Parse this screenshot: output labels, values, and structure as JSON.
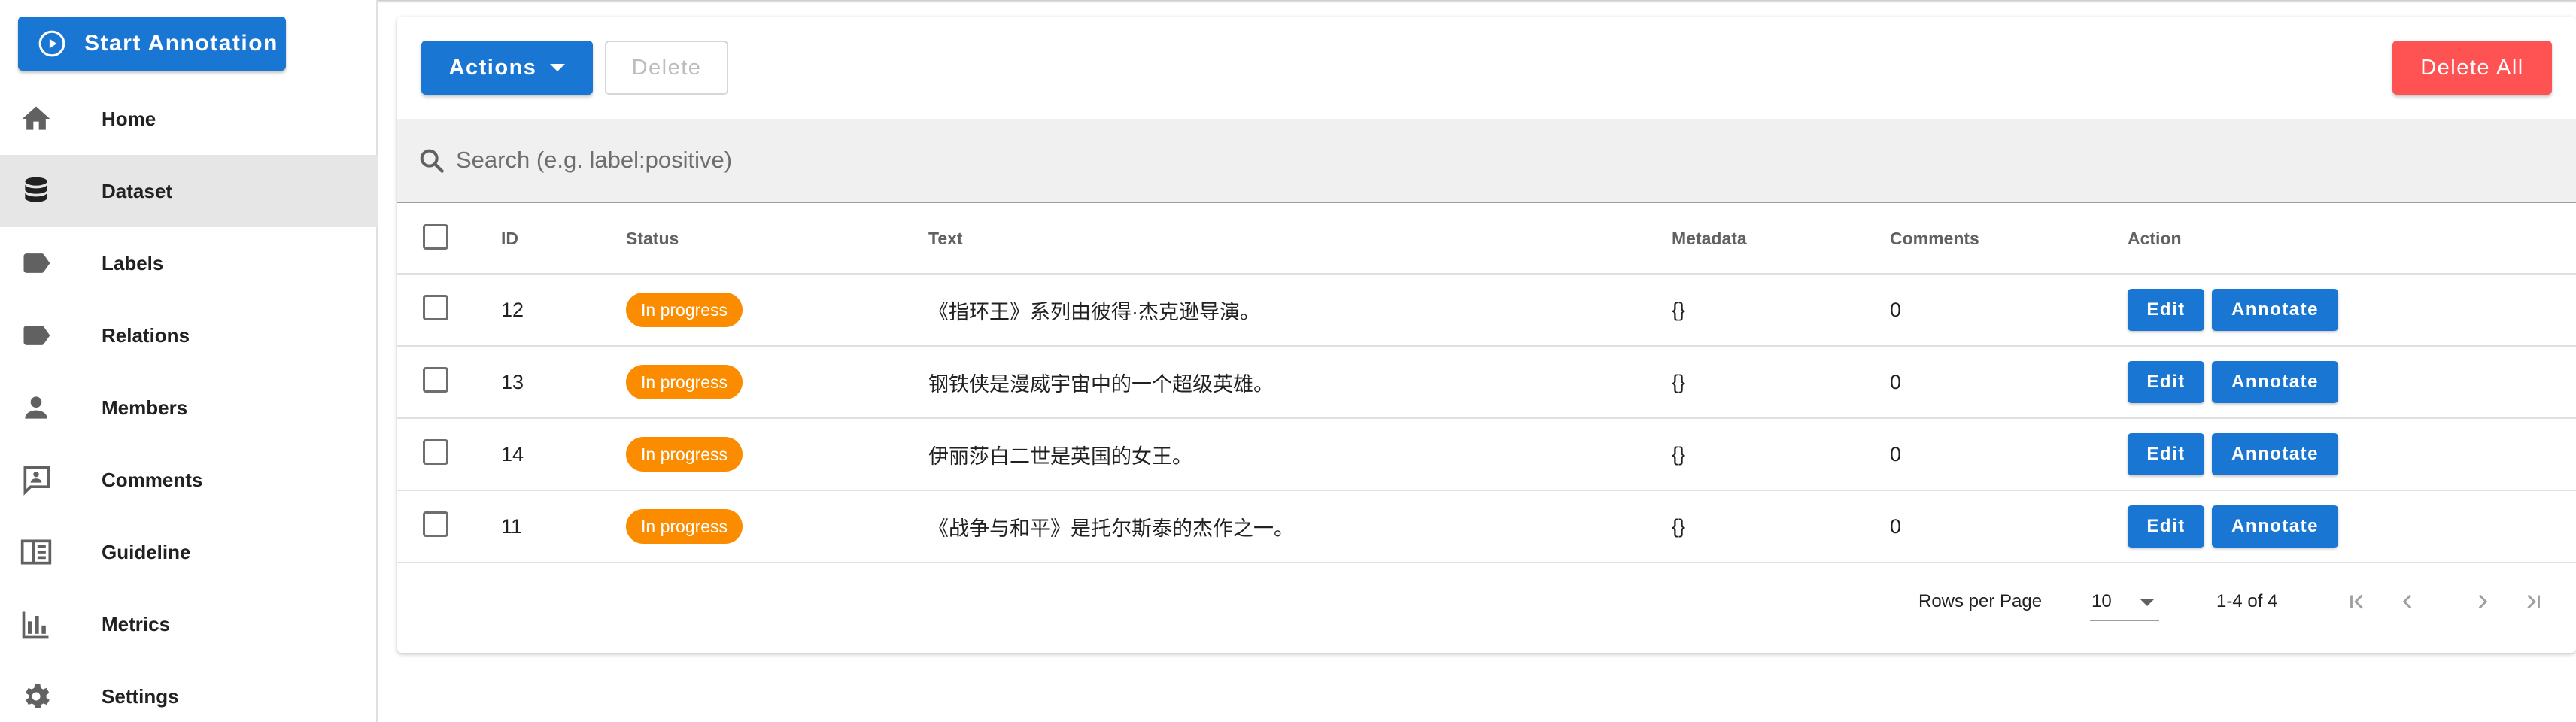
{
  "sidebar": {
    "start_button": "Start Annotation",
    "items": [
      {
        "label": "Home",
        "icon": "home-icon"
      },
      {
        "label": "Dataset",
        "icon": "database-icon"
      },
      {
        "label": "Labels",
        "icon": "label-icon"
      },
      {
        "label": "Relations",
        "icon": "label-icon"
      },
      {
        "label": "Members",
        "icon": "person-icon"
      },
      {
        "label": "Comments",
        "icon": "comment-icon"
      },
      {
        "label": "Guideline",
        "icon": "book-icon"
      },
      {
        "label": "Metrics",
        "icon": "bar-chart-icon"
      },
      {
        "label": "Settings",
        "icon": "gear-icon"
      }
    ],
    "active": "Dataset"
  },
  "toolbar": {
    "actions_label": "Actions",
    "delete_label": "Delete",
    "delete_all_label": "Delete All"
  },
  "search": {
    "placeholder": "Search (e.g. label:positive)",
    "value": ""
  },
  "table": {
    "headers": [
      "ID",
      "Status",
      "Text",
      "Metadata",
      "Comments",
      "Action"
    ],
    "rows": [
      {
        "id": "12",
        "status": "In progress",
        "text": "《指环王》系列由彼得·杰克逊导演。",
        "metadata": "{}",
        "comments": "0"
      },
      {
        "id": "13",
        "status": "In progress",
        "text": "钢铁侠是漫威宇宙中的一个超级英雄。",
        "metadata": "{}",
        "comments": "0"
      },
      {
        "id": "14",
        "status": "In progress",
        "text": "伊丽莎白二世是英国的女王。",
        "metadata": "{}",
        "comments": "0"
      },
      {
        "id": "11",
        "status": "In progress",
        "text": "《战争与和平》是托尔斯泰的杰作之一。",
        "metadata": "{}",
        "comments": "0"
      }
    ],
    "edit_label": "Edit",
    "annotate_label": "Annotate"
  },
  "footer": {
    "rows_per_page_label": "Rows per Page",
    "rows_per_page_value": "10",
    "range": "1-4 of 4"
  },
  "colors": {
    "primary": "#1976d2",
    "danger": "#ff5252",
    "status_in_progress": "#fb8c00"
  }
}
